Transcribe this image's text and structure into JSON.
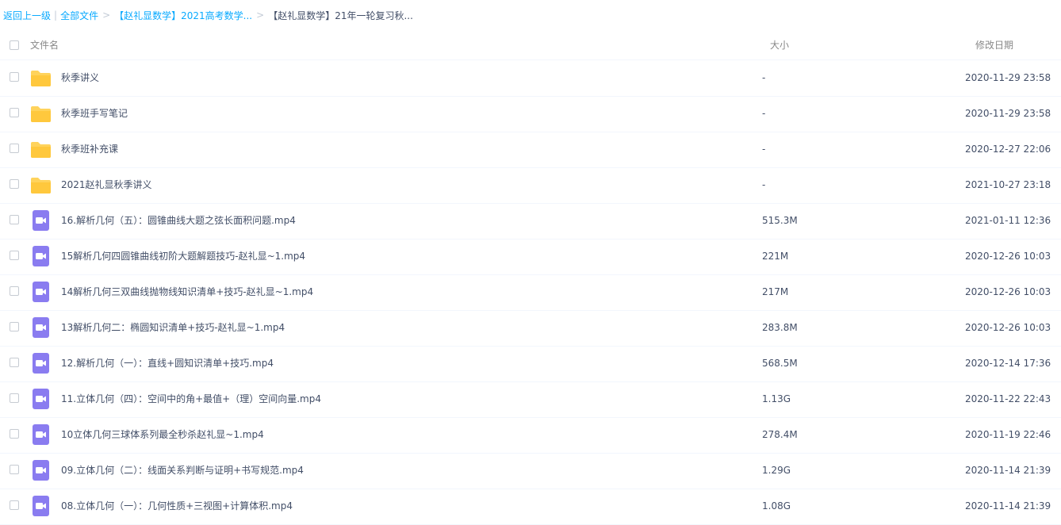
{
  "breadcrumb": {
    "back": "返回上一级",
    "all_files": "全部文件",
    "parent": "【赵礼显数学】2021高考数学...",
    "current": "【赵礼显数学】21年一轮复习秋..."
  },
  "columns": {
    "name": "文件名",
    "size": "大小",
    "date": "修改日期"
  },
  "colors": {
    "link": "#09aaff",
    "folder": "#ffd35c",
    "video": "#8a7cf0"
  },
  "rows": [
    {
      "type": "folder",
      "icon": "folder-icon",
      "name": "秋季讲义",
      "size": "-",
      "date": "2020-11-29 23:58"
    },
    {
      "type": "folder",
      "icon": "folder-icon",
      "name": "秋季班手写笔记",
      "size": "-",
      "date": "2020-11-29 23:58"
    },
    {
      "type": "folder",
      "icon": "folder-icon",
      "name": "秋季班补充课",
      "size": "-",
      "date": "2020-12-27 22:06"
    },
    {
      "type": "folder",
      "icon": "folder-icon",
      "name": "2021赵礼显秋季讲义",
      "size": "-",
      "date": "2021-10-27 23:18"
    },
    {
      "type": "video",
      "icon": "video-file-icon",
      "name": "16.解析几何（五）：圆锥曲线大题之弦长面积问题.mp4",
      "size": "515.3M",
      "date": "2021-01-11 12:36"
    },
    {
      "type": "video",
      "icon": "video-file-icon",
      "name": "15解析几何四圆锥曲线初阶大题解题技巧-赵礼显~1.mp4",
      "size": "221M",
      "date": "2020-12-26 10:03"
    },
    {
      "type": "video",
      "icon": "video-file-icon",
      "name": "14解析几何三双曲线抛物线知识清单+技巧-赵礼显~1.mp4",
      "size": "217M",
      "date": "2020-12-26 10:03"
    },
    {
      "type": "video",
      "icon": "video-file-icon",
      "name": "13解析几何二：椭圆知识清单+技巧-赵礼显~1.mp4",
      "size": "283.8M",
      "date": "2020-12-26 10:03"
    },
    {
      "type": "video",
      "icon": "video-file-icon",
      "name": "12.解析几何（一）：直线+圆知识清单+技巧.mp4",
      "size": "568.5M",
      "date": "2020-12-14 17:36"
    },
    {
      "type": "video",
      "icon": "video-file-icon",
      "name": "11.立体几何（四）：空间中的角+最值+（理）空间向量.mp4",
      "size": "1.13G",
      "date": "2020-11-22 22:43"
    },
    {
      "type": "video",
      "icon": "video-file-icon",
      "name": "10立体几何三球体系列最全秒杀赵礼显~1.mp4",
      "size": "278.4M",
      "date": "2020-11-19 22:46"
    },
    {
      "type": "video",
      "icon": "video-file-icon",
      "name": "09.立体几何（二）：线面关系判断与证明+书写规范.mp4",
      "size": "1.29G",
      "date": "2020-11-14 21:39"
    },
    {
      "type": "video",
      "icon": "video-file-icon",
      "name": "08.立体几何（一）：几何性质+三视图+计算体积.mp4",
      "size": "1.08G",
      "date": "2020-11-14 21:39"
    }
  ]
}
